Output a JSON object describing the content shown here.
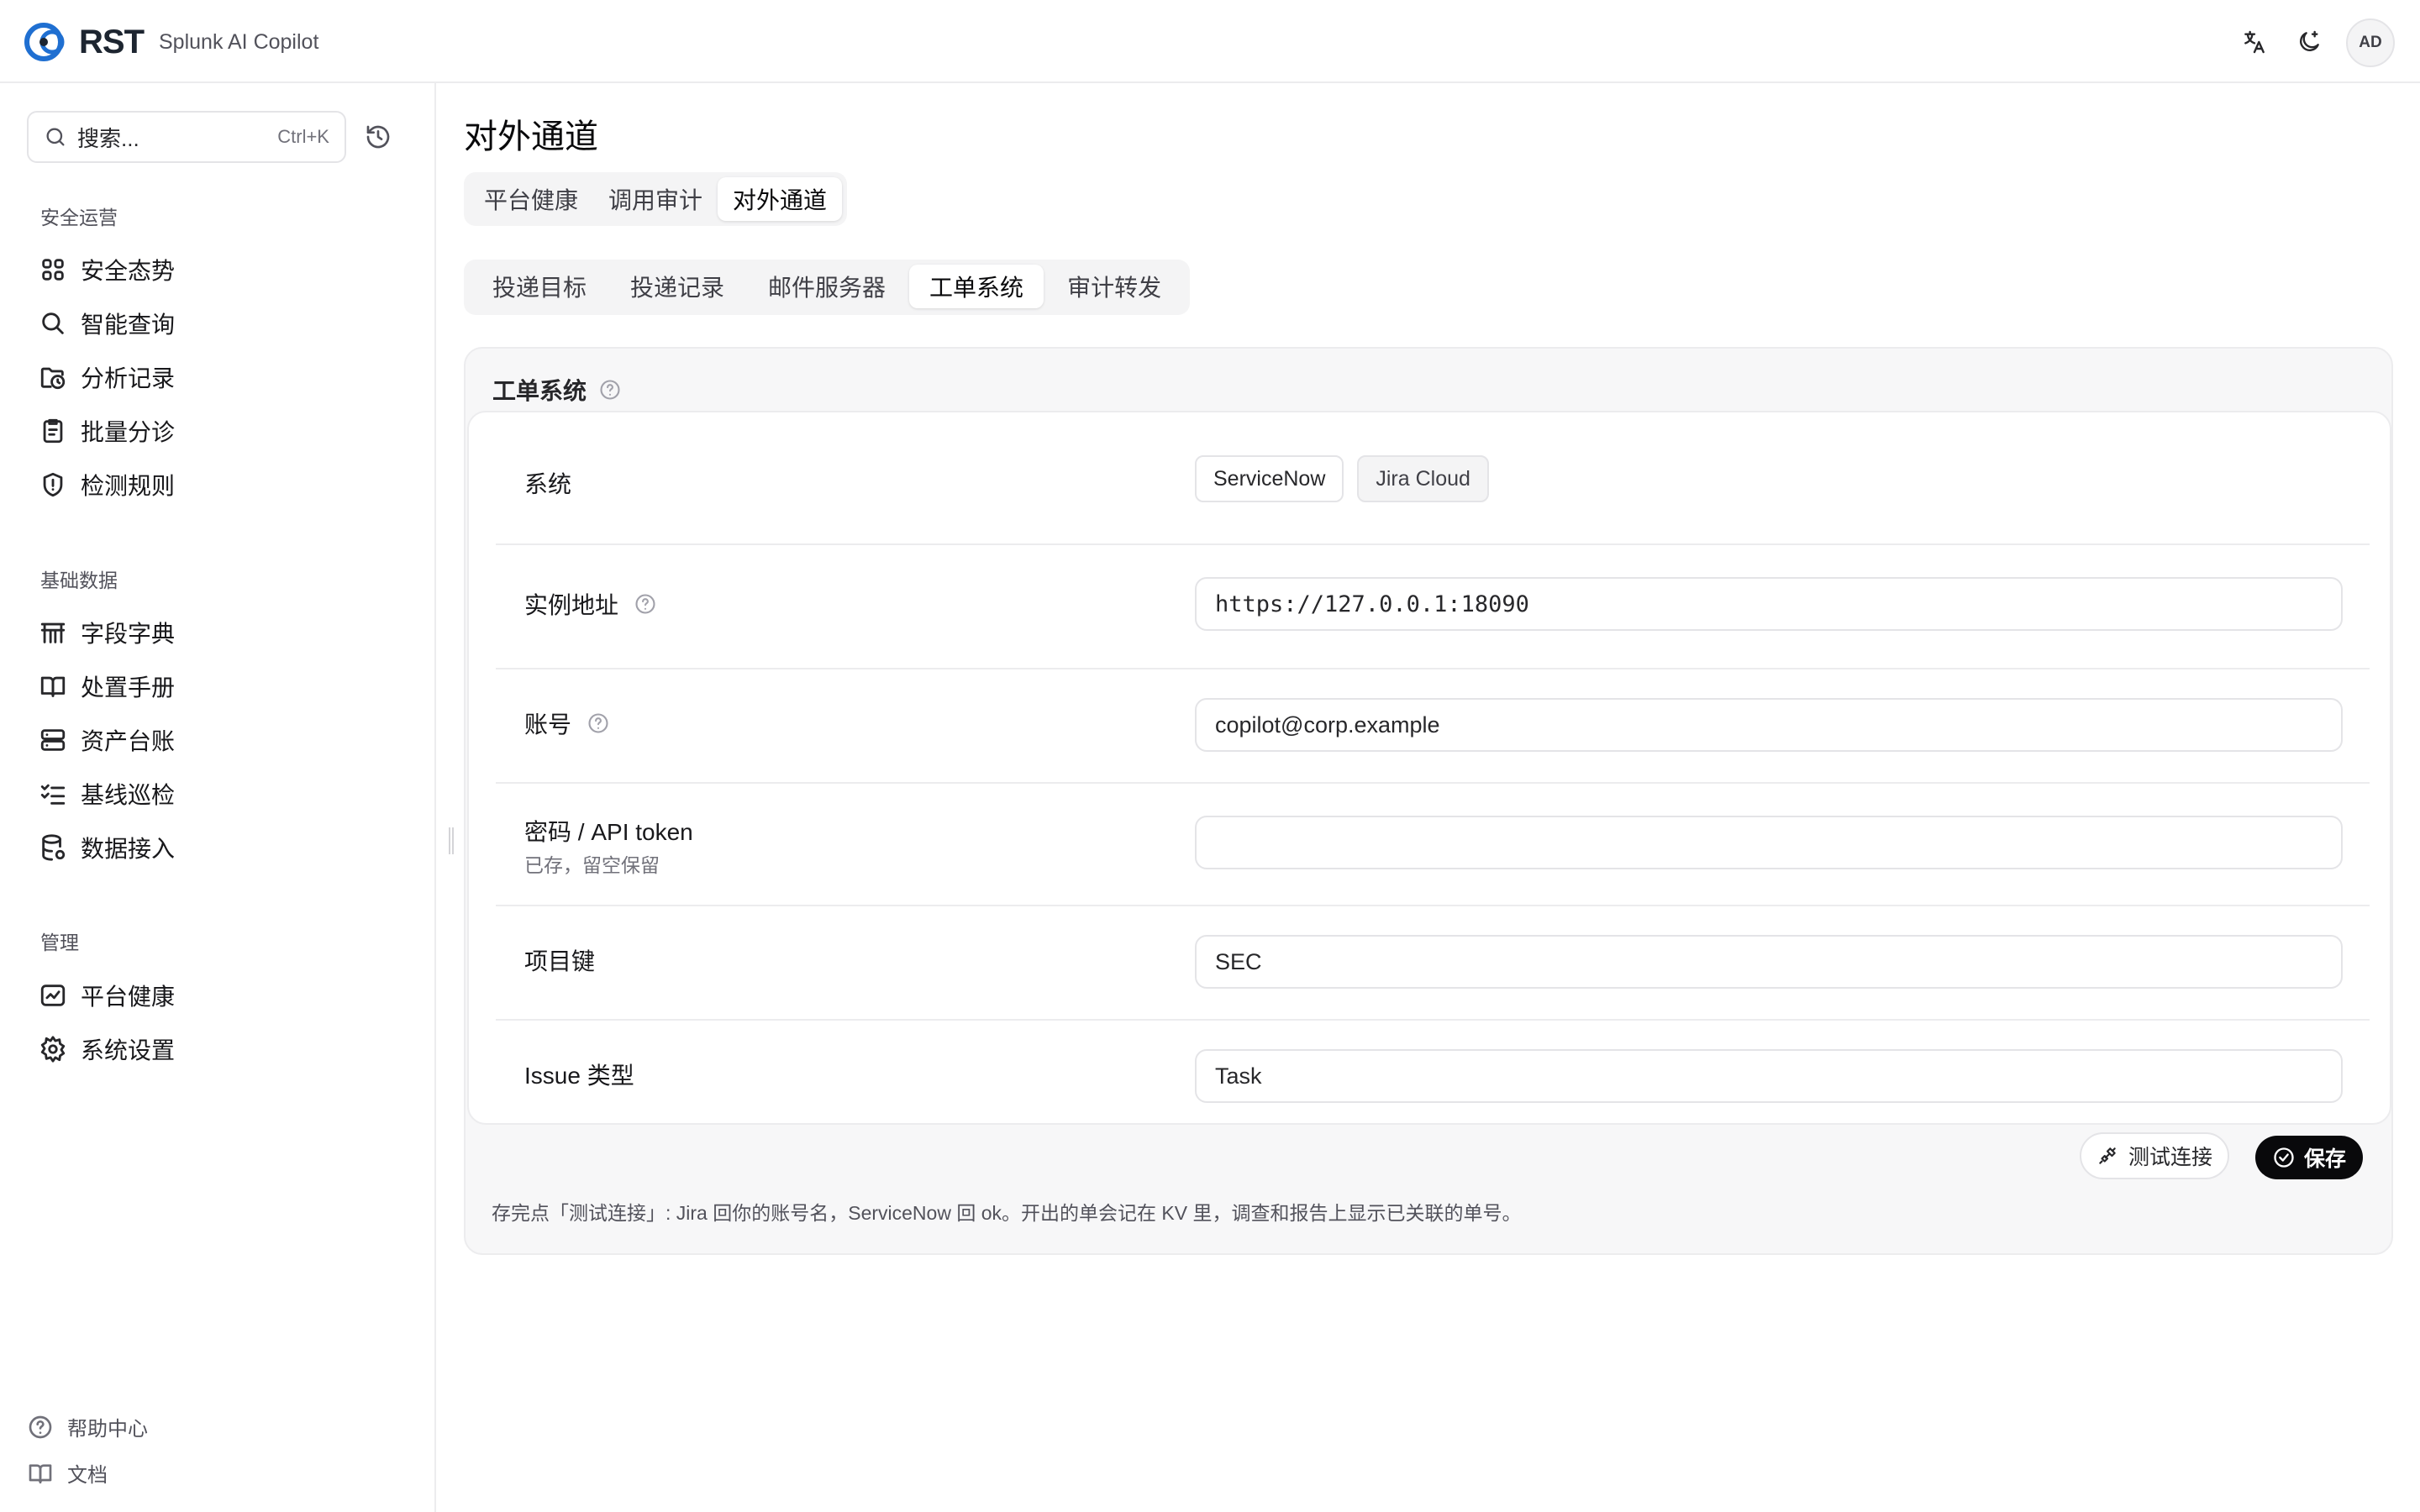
{
  "header": {
    "logo_text": "RST",
    "app_name": "Splunk AI Copilot",
    "avatar": "AD",
    "icons": [
      "translate-icon",
      "theme-moon-icon"
    ]
  },
  "sidebar": {
    "search": {
      "placeholder": "搜索...",
      "shortcut": "Ctrl+K"
    },
    "sections": [
      {
        "title": "安全运营",
        "items": [
          {
            "label": "安全态势",
            "icon": "dashboard-grid-icon"
          },
          {
            "label": "智能查询",
            "icon": "search-icon"
          },
          {
            "label": "分析记录",
            "icon": "folder-clock-icon"
          },
          {
            "label": "批量分诊",
            "icon": "clipboard-list-icon"
          },
          {
            "label": "检测规则",
            "icon": "shield-alert-icon"
          }
        ]
      },
      {
        "title": "基础数据",
        "items": [
          {
            "label": "字段字典",
            "icon": "table-icon"
          },
          {
            "label": "处置手册",
            "icon": "book-icon"
          },
          {
            "label": "资产台账",
            "icon": "server-icon"
          },
          {
            "label": "基线巡检",
            "icon": "list-checks-icon"
          },
          {
            "label": "数据接入",
            "icon": "database-icon"
          }
        ]
      },
      {
        "title": "管理",
        "items": [
          {
            "label": "平台健康",
            "icon": "activity-icon"
          },
          {
            "label": "系统设置",
            "icon": "gear-icon"
          }
        ]
      }
    ],
    "footer": [
      {
        "label": "帮助中心",
        "icon": "help-circle-icon"
      },
      {
        "label": "文档",
        "icon": "book-open-icon"
      }
    ]
  },
  "main": {
    "title": "对外通道",
    "tabs": [
      {
        "label": "平台健康",
        "active": false
      },
      {
        "label": "调用审计",
        "active": false
      },
      {
        "label": "对外通道",
        "active": true
      }
    ],
    "subtabs": [
      {
        "label": "投递目标",
        "active": false
      },
      {
        "label": "投递记录",
        "active": false
      },
      {
        "label": "邮件服务器",
        "active": false
      },
      {
        "label": "工单系统",
        "active": true
      },
      {
        "label": "审计转发",
        "active": false
      }
    ],
    "card": {
      "title": "工单系统",
      "fields": {
        "system": {
          "label": "系统",
          "options": [
            "ServiceNow",
            "Jira Cloud"
          ],
          "selected": "Jira Cloud"
        },
        "instance_url": {
          "label": "实例地址",
          "value": "https://127.0.0.1:18090"
        },
        "account": {
          "label": "账号",
          "value": "copilot@corp.example"
        },
        "password": {
          "label": "密码 / API token",
          "hint": "已存，留空保留",
          "value": ""
        },
        "project_key": {
          "label": "项目键",
          "value": "SEC"
        },
        "issue_type": {
          "label": "Issue 类型",
          "value": "Task"
        }
      },
      "test_button": "测试连接",
      "save_button": "保存",
      "footnote": "存完点「测试连接」: Jira 回你的账号名，ServiceNow 回 ok。开出的单会记在 KV 里，调查和报告上显示已关联的单号。"
    }
  }
}
